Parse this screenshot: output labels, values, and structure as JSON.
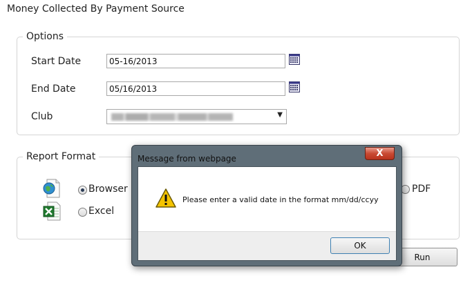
{
  "page": {
    "title": "Money Collected By Payment Source"
  },
  "options": {
    "legend": "Options",
    "start_date": {
      "label": "Start Date",
      "value": "05-16/2013"
    },
    "end_date": {
      "label": "End Date",
      "value": "05/16/2013"
    },
    "club": {
      "label": "Club",
      "value_obscured": true
    }
  },
  "report_format": {
    "legend": "Report Format",
    "options": [
      {
        "label": "Browser",
        "icon": "browser-globe-icon",
        "checked": true
      },
      {
        "label": "Excel",
        "icon": "excel-icon",
        "checked": false
      },
      {
        "label": "PDF",
        "checked": false
      }
    ]
  },
  "run_button": {
    "label": "Run"
  },
  "dialog": {
    "title": "Message from webpage",
    "close_glyph": "X",
    "message": "Please enter a valid date in the format mm/dd/ccyy",
    "ok_label": "OK",
    "icon": "warning-icon"
  },
  "colors": {
    "dialog_frame": "#5f6e78",
    "close_button": "#c94a33",
    "warning": "#f5c400"
  }
}
